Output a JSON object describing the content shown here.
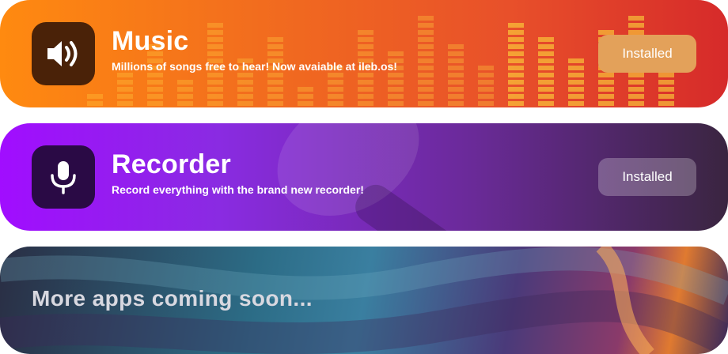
{
  "apps": [
    {
      "title": "Music",
      "description": "Millions of songs free to hear! Now avaiable at ileb.os!",
      "button_label": "Installed",
      "icon": "speaker-icon",
      "accent": "#ff8a10"
    },
    {
      "title": "Recorder",
      "description": "Record everything with the brand new recorder!",
      "button_label": "Installed",
      "icon": "microphone-icon",
      "accent": "#a10dff"
    }
  ],
  "more": {
    "text": "More apps coming soon..."
  }
}
